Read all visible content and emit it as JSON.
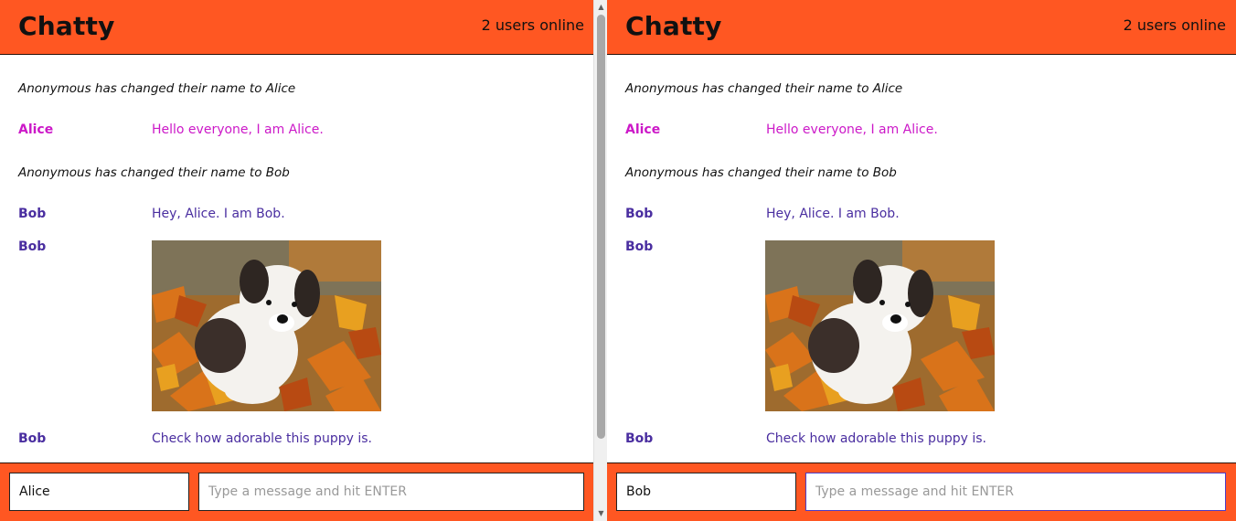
{
  "left": {
    "brand": "Chatty",
    "online": "2 users online",
    "messages": [
      {
        "type": "system",
        "text": "Anonymous has changed their name to Alice"
      },
      {
        "type": "message",
        "user": "Alice",
        "text": "Hello everyone, I am Alice."
      },
      {
        "type": "system",
        "text": "Anonymous has changed their name to Bob"
      },
      {
        "type": "message",
        "user": "Bob",
        "text": "Hey, Alice. I am Bob."
      },
      {
        "type": "image",
        "user": "Bob"
      },
      {
        "type": "message",
        "user": "Bob",
        "text": "Check how adorable this puppy is."
      }
    ],
    "footer": {
      "name": "Alice",
      "placeholder": "Type a message and hit ENTER"
    }
  },
  "right": {
    "brand": "Chatty",
    "online": "2 users online",
    "messages": [
      {
        "type": "system",
        "text": "Anonymous has changed their name to Alice"
      },
      {
        "type": "message",
        "user": "Alice",
        "text": "Hello everyone, I am Alice."
      },
      {
        "type": "system",
        "text": "Anonymous has changed their name to Bob"
      },
      {
        "type": "message",
        "user": "Bob",
        "text": "Hey, Alice. I am Bob."
      },
      {
        "type": "image",
        "user": "Bob"
      },
      {
        "type": "message",
        "user": "Bob",
        "text": "Check how adorable this puppy is."
      }
    ],
    "footer": {
      "name": "Bob",
      "placeholder": "Type a message and hit ENTER"
    }
  },
  "colors": {
    "accent": "#ff5722",
    "alice": "#cc19c8",
    "bob": "#4a2ea0"
  }
}
